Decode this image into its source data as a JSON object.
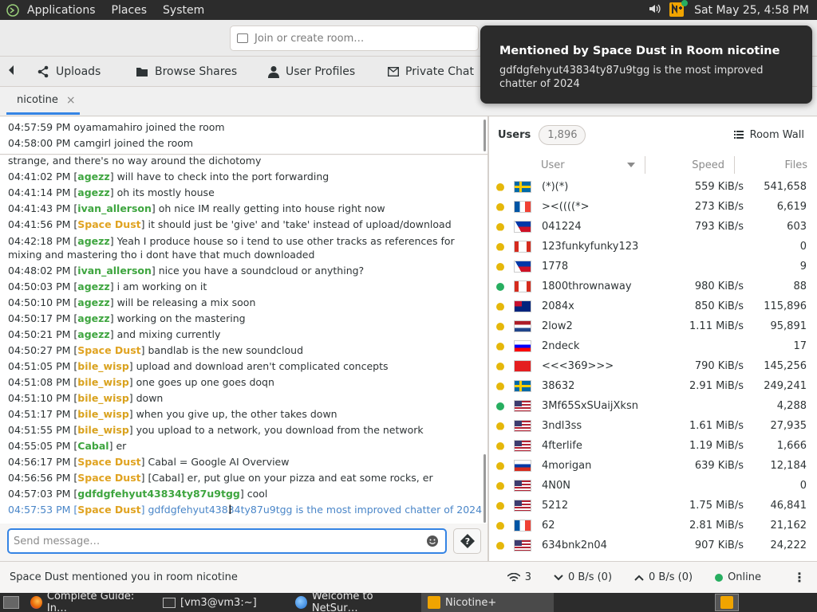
{
  "top_panel": {
    "menus": [
      "Applications",
      "Places",
      "System"
    ],
    "clock": "Sat May 25,  4:58 PM"
  },
  "header": {
    "room_placeholder": "Join or create room…"
  },
  "nav_tabs": [
    "Uploads",
    "Browse Shares",
    "User Profiles",
    "Private Chat"
  ],
  "room_tab": "nicotine",
  "join_log": [
    "04:57:59 PM oyamamahiro joined the room",
    "04:58:00 PM camgirl joined the room"
  ],
  "chat": {
    "partial_top": "strange, and there's no way around the dichotomy",
    "lines": [
      {
        "time": "04:41:02 PM",
        "user": "agezz",
        "text": "will have to check into the port forwarding"
      },
      {
        "time": "04:41:14 PM",
        "user": "agezz",
        "text": "oh its mostly house"
      },
      {
        "time": "04:41:43 PM",
        "user": "ivan_allerson",
        "text": "oh nice IM really getting into house right now"
      },
      {
        "time": "04:41:56 PM",
        "user": "Space Dust",
        "text": "it should just be 'give' and 'take' instead of upload/download"
      },
      {
        "time": "04:42:18 PM",
        "user": "agezz",
        "text": "Yeah I produce house so i tend to use other tracks as references for mixing and mastering tho i dont have that much downloaded"
      },
      {
        "time": "04:48:02 PM",
        "user": "ivan_allerson",
        "text": "nice you have a soundcloud or anything?"
      },
      {
        "time": "04:50:03 PM",
        "user": "agezz",
        "text": "i am working on it"
      },
      {
        "time": "04:50:10 PM",
        "user": "agezz",
        "text": "will be releasing a mix soon"
      },
      {
        "time": "04:50:17 PM",
        "user": "agezz",
        "text": "working on the mastering"
      },
      {
        "time": "04:50:21 PM",
        "user": "agezz",
        "text": "and mixing currently"
      },
      {
        "time": "04:50:27 PM",
        "user": "Space Dust",
        "text": "bandlab is the new soundcloud"
      },
      {
        "time": "04:51:05 PM",
        "user": "bile_wisp",
        "text": "upload and download aren't complicated concepts"
      },
      {
        "time": "04:51:08 PM",
        "user": "bile_wisp",
        "text": "one goes up one goes doqn"
      },
      {
        "time": "04:51:10 PM",
        "user": "bile_wisp",
        "text": "down"
      },
      {
        "time": "04:51:17 PM",
        "user": "bile_wisp",
        "text": "when you give up, the other takes down"
      },
      {
        "time": "04:51:55 PM",
        "user": "bile_wisp",
        "text": "you upload to a network, you download from the network"
      },
      {
        "time": "04:55:05 PM",
        "user": "Cabal",
        "text": "er"
      },
      {
        "time": "04:56:17 PM",
        "user": "Space Dust",
        "text": "Cabal = Google AI Overview"
      },
      {
        "time": "04:56:56 PM",
        "user": "Space Dust",
        "text": "[Cabal] er, put glue on your pizza and eat some rocks, er"
      },
      {
        "time": "04:57:03 PM",
        "user": "gdfdgfehyut43834ty87u9tgg",
        "text": "cool"
      }
    ],
    "mention_line": {
      "time": "04:57:53 PM",
      "user": "Space Dust",
      "text": "gdfdgfehyut43834ty87u9tgg is the most improved chatter of 2024"
    },
    "input_placeholder": "Send message…",
    "help_label": "?"
  },
  "users_pane": {
    "title": "Users",
    "count": "1,896",
    "room_wall": "Room Wall",
    "columns": {
      "user": "User",
      "speed": "Speed",
      "files": "Files"
    },
    "rows": [
      {
        "name": "(*)(*)",
        "speed": "559 KiB/s",
        "files": "541,658",
        "status": "away",
        "flag": "se"
      },
      {
        "name": "><((((*>",
        "speed": "273 KiB/s",
        "files": "6,619",
        "status": "away",
        "flag": "fr"
      },
      {
        "name": "041224",
        "speed": "793 KiB/s",
        "files": "603",
        "status": "away",
        "flag": "ph"
      },
      {
        "name": "123funkyfunky123",
        "speed": "",
        "files": "0",
        "status": "away",
        "flag": "ca"
      },
      {
        "name": "1778",
        "speed": "",
        "files": "9",
        "status": "away",
        "flag": "ph"
      },
      {
        "name": "1800thrownaway",
        "speed": "980 KiB/s",
        "files": "88",
        "status": "online",
        "flag": "ca"
      },
      {
        "name": "2084x",
        "speed": "850 KiB/s",
        "files": "115,896",
        "status": "away",
        "flag": "au"
      },
      {
        "name": "2low2",
        "speed": "1.11 MiB/s",
        "files": "95,891",
        "status": "away",
        "flag": "nl"
      },
      {
        "name": "2ndeck",
        "speed": "",
        "files": "17",
        "status": "away",
        "flag": "si"
      },
      {
        "name": "<<<369>>>",
        "speed": "790 KiB/s",
        "files": "145,256",
        "status": "away",
        "flag": "al"
      },
      {
        "name": "38632",
        "speed": "2.91 MiB/s",
        "files": "249,241",
        "status": "away",
        "flag": "se"
      },
      {
        "name": "3Mf65SxSUaijXksn",
        "speed": "",
        "files": "4,288",
        "status": "online",
        "flag": "us"
      },
      {
        "name": "3ndl3ss",
        "speed": "1.61 MiB/s",
        "files": "27,935",
        "status": "away",
        "flag": "us"
      },
      {
        "name": "4fterlife",
        "speed": "1.19 MiB/s",
        "files": "1,666",
        "status": "away",
        "flag": "us"
      },
      {
        "name": "4morigan",
        "speed": "639 KiB/s",
        "files": "12,184",
        "status": "away",
        "flag": "ru"
      },
      {
        "name": "4N0N",
        "speed": "",
        "files": "0",
        "status": "away",
        "flag": "us"
      },
      {
        "name": "5212",
        "speed": "1.75 MiB/s",
        "files": "46,841",
        "status": "away",
        "flag": "us"
      },
      {
        "name": "62",
        "speed": "2.81 MiB/s",
        "files": "21,162",
        "status": "away",
        "flag": "fr"
      },
      {
        "name": "634bnk2n04",
        "speed": "907 KiB/s",
        "files": "24,222",
        "status": "away",
        "flag": "us"
      }
    ]
  },
  "status_bar": {
    "message": "Space Dust mentioned you in room nicotine",
    "connections": "3",
    "download": "0 B/s (0)",
    "upload": "0 B/s (0)",
    "state": "Online"
  },
  "taskbar": {
    "tasks": [
      "Complete Guide: In…",
      "[vm3@vm3:~]",
      "Welcome to NetSur…",
      "Nicotine+"
    ]
  },
  "notification": {
    "title": "Mentioned by Space Dust in Room nicotine",
    "body": "gdfdgfehyut43834ty87u9tgg is the most improved chatter of 2024"
  },
  "colors": {
    "accent": "#3584e4",
    "user_space_dust": "#d9a21e",
    "user_green": "#3ea53f",
    "mention": "#4a86c8"
  }
}
